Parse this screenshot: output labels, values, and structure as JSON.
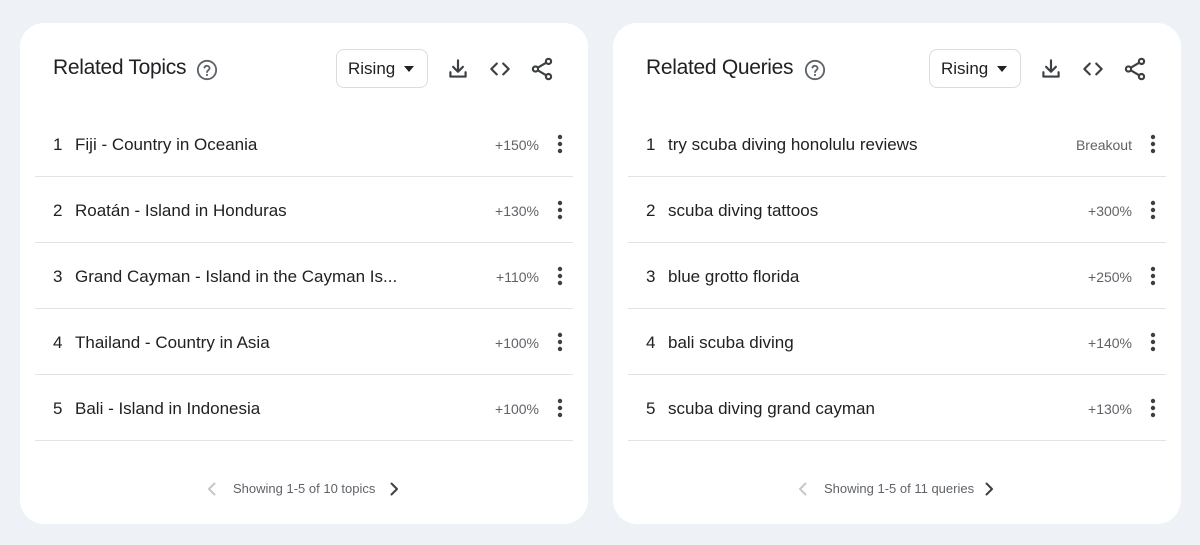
{
  "topics": {
    "title": "Related Topics",
    "filter": "Rising",
    "items": [
      {
        "rank": "1",
        "label": "Fiji - Country in Oceania",
        "value": "+150%"
      },
      {
        "rank": "2",
        "label": "Roatán - Island in Honduras",
        "value": "+130%"
      },
      {
        "rank": "3",
        "label": "Grand Cayman - Island in the Cayman Is...",
        "value": "+110%"
      },
      {
        "rank": "4",
        "label": "Thailand - Country in Asia",
        "value": "+100%"
      },
      {
        "rank": "5",
        "label": "Bali - Island in Indonesia",
        "value": "+100%"
      }
    ],
    "pagination": "Showing 1-5 of 10 topics"
  },
  "queries": {
    "title": "Related Queries",
    "filter": "Rising",
    "items": [
      {
        "rank": "1",
        "label": "try scuba diving honolulu reviews",
        "value": "Breakout"
      },
      {
        "rank": "2",
        "label": "scuba diving tattoos",
        "value": "+300%"
      },
      {
        "rank": "3",
        "label": "blue grotto florida",
        "value": "+250%"
      },
      {
        "rank": "4",
        "label": "bali scuba diving",
        "value": "+140%"
      },
      {
        "rank": "5",
        "label": "scuba diving grand cayman",
        "value": "+130%"
      }
    ],
    "pagination": "Showing 1-5 of 11 queries"
  },
  "icons": {
    "help": "help-circle-icon",
    "download": "download-icon",
    "embed": "code-icon",
    "share": "share-icon",
    "more": "more-vert-icon",
    "prev": "chevron-left-icon",
    "next": "chevron-right-icon"
  }
}
